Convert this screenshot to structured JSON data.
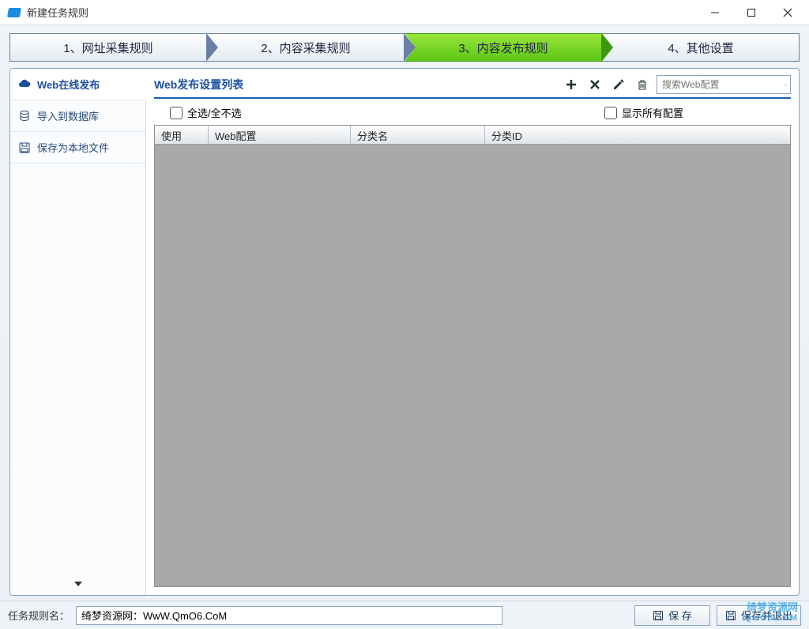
{
  "window": {
    "title": "新建任务规则"
  },
  "steps": {
    "s1": "1、网址采集规则",
    "s2": "2、内容采集规则",
    "s3": "3、内容发布规则",
    "s4": "4、其他设置",
    "active_index": 2
  },
  "sidebar": {
    "items": [
      {
        "label": "Web在线发布",
        "icon": "cloud-icon"
      },
      {
        "label": "导入到数据库",
        "icon": "database-icon"
      },
      {
        "label": "保存为本地文件",
        "icon": "save-file-icon"
      }
    ],
    "active_index": 0
  },
  "panel": {
    "title": "Web发布设置列表",
    "search_placeholder": "搜索Web配置",
    "select_all_label": "全选/全不选",
    "show_all_label": "显示所有配置",
    "columns": {
      "use": "使用",
      "web_config": "Web配置",
      "category_name": "分类名",
      "category_id": "分类ID"
    },
    "rows": []
  },
  "footer": {
    "name_label": "任务规则名：",
    "name_value": "绮梦资源网：WwW.QmO6.CoM",
    "save_label": "保 存",
    "save_exit_label": "保存并退出"
  },
  "watermark": {
    "line1": "绮梦资源网",
    "line2": "QmO6.CoM"
  }
}
